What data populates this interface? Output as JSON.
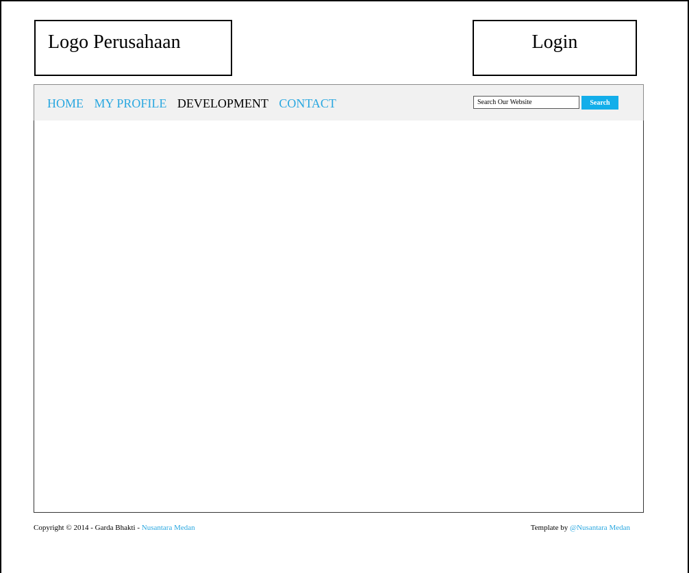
{
  "header": {
    "logo_text": "Logo Perusahaan",
    "login_label": "Login"
  },
  "nav": {
    "items": [
      {
        "label": "HOME",
        "active": false
      },
      {
        "label": "MY PROFILE",
        "active": false
      },
      {
        "label": "DEVELOPMENT",
        "active": true
      },
      {
        "label": "CONTACT",
        "active": false
      }
    ]
  },
  "search": {
    "placeholder": "Search Our Website",
    "button_label": "Search"
  },
  "footer": {
    "copyright_prefix": "Copyright © 2014 - Garda Bhakti - ",
    "copyright_link": "Nusantara Medan",
    "template_prefix": "Template by ",
    "template_link": "@Nusantara Medan"
  },
  "colors": {
    "link": "#29a7e0",
    "search_button": "#13aeea",
    "navbar_bg": "#f1f1f1"
  }
}
